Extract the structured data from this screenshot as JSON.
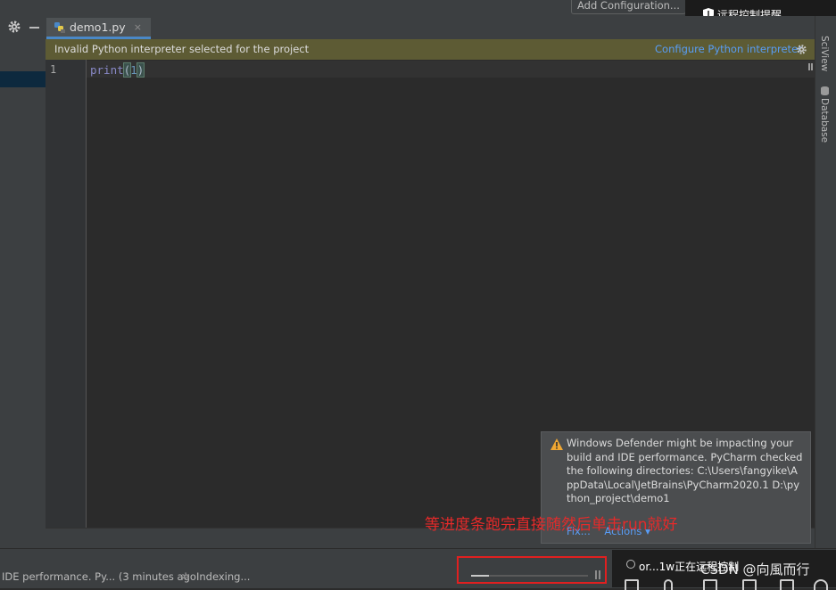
{
  "toolbar": {
    "add_configuration": "Add Configuration..."
  },
  "remote_popup": {
    "text": "远程控制提醒"
  },
  "tabs": [
    {
      "label": "demo1.py",
      "close": "×"
    }
  ],
  "banner": {
    "message": "Invalid Python interpreter selected for the project",
    "action": "Configure Python interpreter"
  },
  "editor": {
    "line_number": "1",
    "code": {
      "fn": "print",
      "open": "(",
      "arg": "1",
      "close": ")"
    }
  },
  "right_strip": {
    "sciview": "SciView",
    "database": "Database"
  },
  "notification": {
    "text": "Windows Defender might be impacting your build and IDE performance. PyCharm checked the following directories: C:\\Users\\fangyike\\AppData\\Local\\JetBrains\\PyCharm2020.1 D:\\python_project\\demo1",
    "links": [
      "Fix...",
      "Actions ▾"
    ]
  },
  "annotation": "等进度条跑完直接随然后单击run就好",
  "status": {
    "left_text": "IDE performance. Py... (3 minutes ago",
    "indexing": "Indexing...",
    "progress": 0.15
  },
  "taskbar": {
    "remote_status": "or...1w正在远程控制",
    "watermark": "CSDN @向風而行"
  },
  "colors": {
    "accent": "#589df6",
    "banner_bg": "#5d5b34",
    "highlight": "#e02020"
  }
}
